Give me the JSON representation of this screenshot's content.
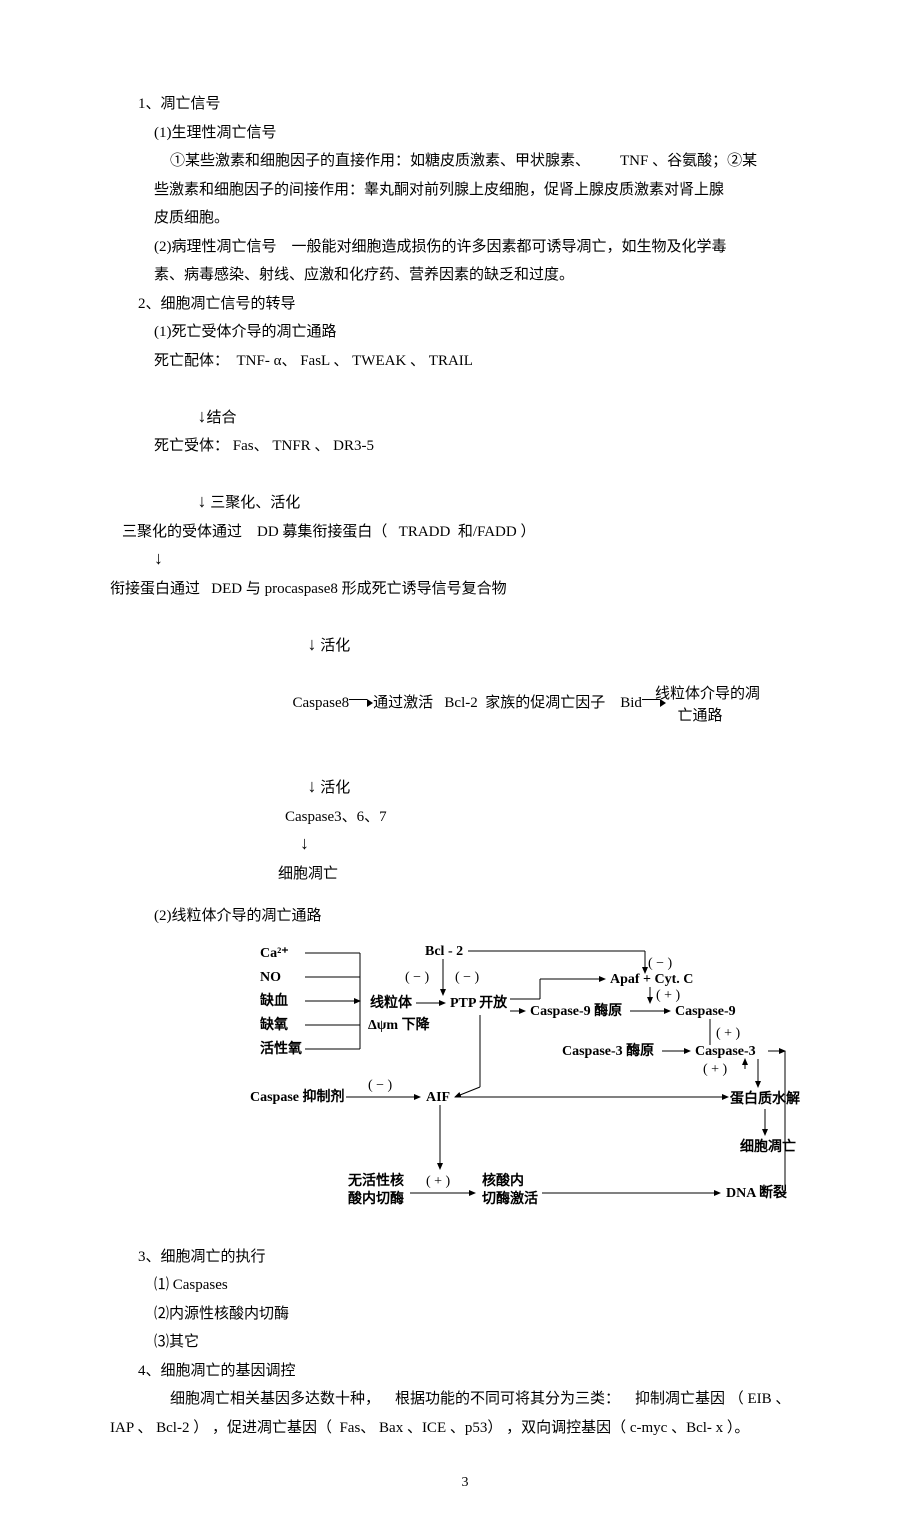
{
  "s1": {
    "h": "1、凋亡信号",
    "p1": {
      "h": "(1)生理性凋亡信号",
      "l1": "①某些激素和细胞因子的直接作用：如糖皮质激素、甲状腺素、        TNF 、谷氨酸；②某",
      "l2": "些激素和细胞因子的间接作用：睾丸酮对前列腺上皮细胞，促肾上腺皮质激素对肾上腺",
      "l3": "皮质细胞。"
    },
    "p2": {
      "l1": "(2)病理性凋亡信号    一般能对细胞造成损伤的许多因素都可诱导凋亡，如生物及化学毒",
      "l2": "素、病毒感染、射线、应激和化疗药、营养因素的缺乏和过度。"
    }
  },
  "s2": {
    "h": "2、细胞凋亡信号的转导",
    "p1": {
      "h": "(1)死亡受体介导的凋亡通路",
      "l1": "死亡配体：  TNF- α、 FasL 、 TWEAK 、 TRAIL",
      "a1": "结合",
      "l2": "死亡受体： Fas、 TNFR 、 DR3-5",
      "a2": "三聚化、活化",
      "l3": "三聚化的受体通过    DD 募集衔接蛋白（   TRADD  和/FADD ）",
      "l4": "衔接蛋白通过   DED 与 procaspase8 形成死亡诱导信号复合物",
      "a3": "活化",
      "l5a": "Caspase8",
      "l5b": "通过激活   Bcl-2  家族的促凋亡因子    Bid",
      "l5c": "线粒体介导的凋",
      "l5d": "亡通路",
      "a4": "活化",
      "l6": "Caspase3、6、7",
      "l7": "细胞凋亡"
    },
    "p2": {
      "h": "(2)线粒体介导的凋亡通路"
    }
  },
  "fig": {
    "left_inputs": [
      "Ca²⁺",
      "NO",
      "缺血",
      "缺氧",
      "活性氧"
    ],
    "bcl2": "Bcl - 2",
    "minus": "( − )",
    "plus": "( + )",
    "mito": "线粒体",
    "ptp": "PTP 开放",
    "dpsi": "Δψm 下降",
    "apaf": "Apaf + Cyt. C",
    "c9pro": "Caspase-9 酶原",
    "c9": "Caspase-9",
    "c3pro": "Caspase-3 酶原",
    "c3": "Caspase-3",
    "prot": "蛋白质水解",
    "apop": "细胞凋亡",
    "dna": "DNA 断裂",
    "casp_inh": "Caspase 抑制剂",
    "aif": "AIF",
    "endo_inactive_a": "无活性核",
    "endo_inactive_b": "酸内切酶",
    "endo_active_a": "核酸内",
    "endo_active_b": "切酶激活"
  },
  "s3": {
    "h": "3、细胞凋亡的执行",
    "l1": "⑴ Caspases",
    "l2": "⑵内源性核酸内切酶",
    "l3": "⑶其它"
  },
  "s4": {
    "h": "4、细胞凋亡的基因调控",
    "l1": "细胞凋亡相关基因多达数十种，    根据功能的不同可将其分为三类：    抑制凋亡基因 （ EIB 、",
    "l2": "IAP 、 Bcl-2 ） ，促进凋亡基因（  Fas、 Bax 、ICE 、p53） ，双向调控基因（ c-myc 、Bcl- x ）。"
  },
  "page": "3"
}
